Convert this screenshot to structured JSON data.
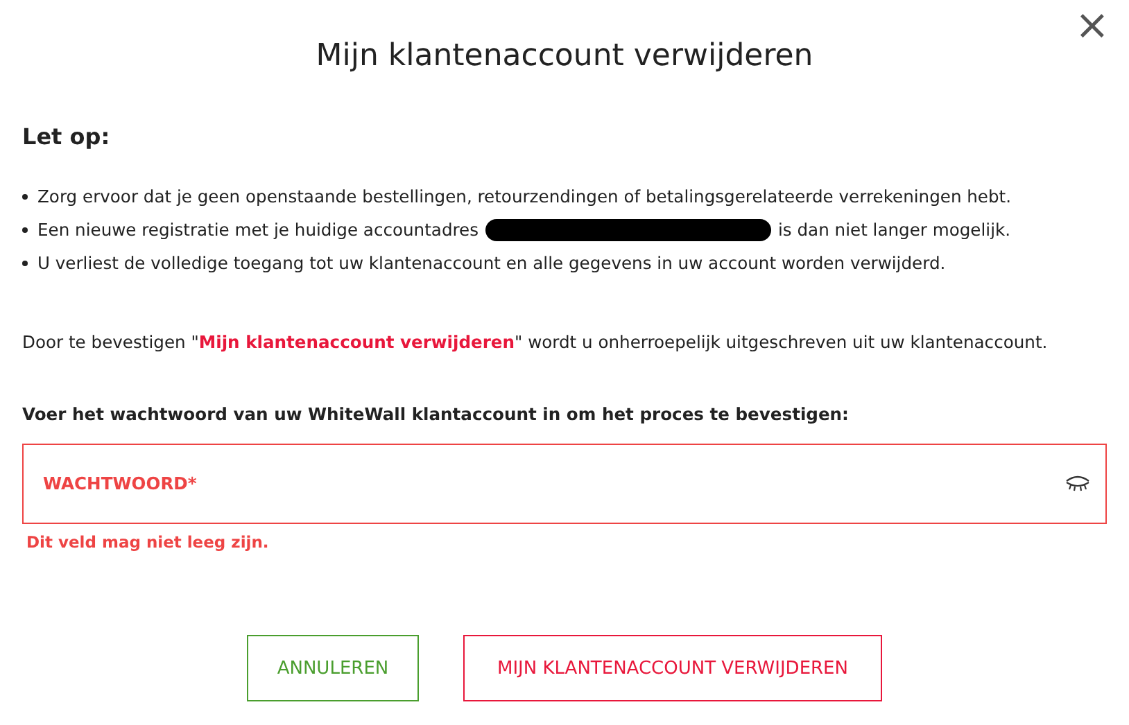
{
  "dialog": {
    "title": "Mijn klantenaccount verwijderen",
    "close_label": "×"
  },
  "notice": {
    "heading": "Let op:",
    "bullets": [
      {
        "text_before": "Zorg ervoor dat je geen openstaande bestellingen, retourzendingen of betalingsgerelateerde verrekeningen hebt.",
        "redacted": false
      },
      {
        "text_before": "Een nieuwe registratie met je huidige accountadres",
        "redacted": true,
        "text_after": "is dan niet langer mogelijk."
      },
      {
        "text_before": "U verliest de volledige toegang tot uw klantenaccount en alle gegevens in uw account worden verwijderd.",
        "redacted": false
      }
    ]
  },
  "confirm_text": "Door te bevestigen \"**Mijn klantenaccount verwijderen**\" wordt u onherroepelijk uitgeschreven uit uw klantenaccount.",
  "password": {
    "prompt": "Voer het wachtwoord van uw WhiteWall klantaccount in om het proces te bevestigen:",
    "placeholder": "WACHTWOORD*",
    "error": true,
    "error_text": "Dit veld mag niet leeg zijn."
  },
  "buttons": [
    {
      "kind": "cancel",
      "label": "ANNULEREN"
    },
    {
      "kind": "danger",
      "label": "MIJN KLANTENACCOUNT VERWIJDEREN"
    }
  ]
}
